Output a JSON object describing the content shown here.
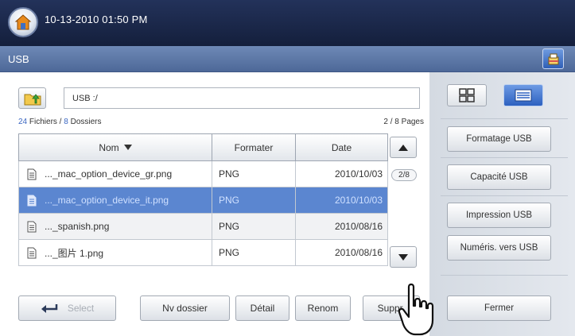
{
  "status_bar": {
    "datetime": "10-13-2010 01:50 PM"
  },
  "header": {
    "title": "USB"
  },
  "browser": {
    "path": "USB :/",
    "files_count": "24",
    "files_label": " Fichiers / ",
    "folders_count": "8",
    "folders_label": " Dossiers",
    "pages": "2 / 8  Pages",
    "page_indicator": "2/8"
  },
  "table": {
    "columns": [
      "Nom",
      "Formater",
      "Date"
    ],
    "rows": [
      {
        "name": "..._mac_option_device_gr.png",
        "format": "PNG",
        "date": "2010/10/03",
        "selected": false
      },
      {
        "name": "..._mac_option_device_it.png",
        "format": "PNG",
        "date": "2010/10/03",
        "selected": true
      },
      {
        "name": "..._spanish.png",
        "format": "PNG",
        "date": "2010/08/16",
        "selected": false
      },
      {
        "name": "..._图片 1.png",
        "format": "PNG",
        "date": "2010/08/16",
        "selected": false
      }
    ]
  },
  "bottom_buttons": {
    "select": "Select",
    "new_folder": "Nv dossier",
    "detail": "Détail",
    "rename": "Renom",
    "delete": "Suppr."
  },
  "side_buttons": {
    "format": "Formatage USB",
    "capacity": "Capacité USB",
    "print": "Impression USB",
    "scan": "Numéris. vers USB",
    "close": "Fermer"
  },
  "colors": {
    "top_bar": "#1a2647",
    "title_bar": "#5a76a8",
    "selection": "#5b86d0",
    "accent_blue": "#3a66c2"
  }
}
